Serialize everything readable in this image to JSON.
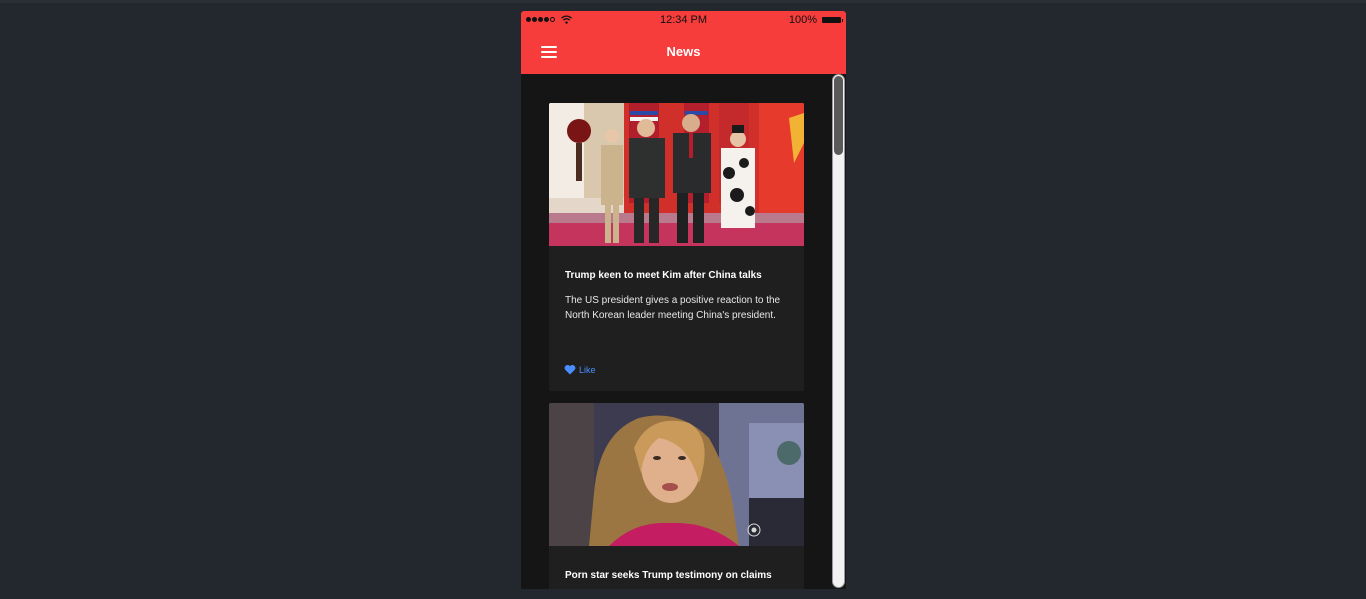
{
  "status_bar": {
    "time": "12:34 PM",
    "battery": "100%"
  },
  "nav": {
    "title": "News"
  },
  "articles": [
    {
      "title": "Trump keen to meet Kim after China talks",
      "summary": "The US president gives a positive reaction to the North Korean leader meeting China's president.",
      "like_label": "Like"
    },
    {
      "title": "Porn star seeks Trump testimony on claims"
    }
  ],
  "colors": {
    "accent": "#f73c3c",
    "like": "#4a8dff",
    "card_bg": "#1f1f1f",
    "page_bg": "#23272e"
  },
  "icons": {
    "menu": "hamburger-menu-icon",
    "like": "heart-icon",
    "wifi": "wifi-icon",
    "battery": "battery-icon",
    "signal": "signal-strength-icon"
  }
}
